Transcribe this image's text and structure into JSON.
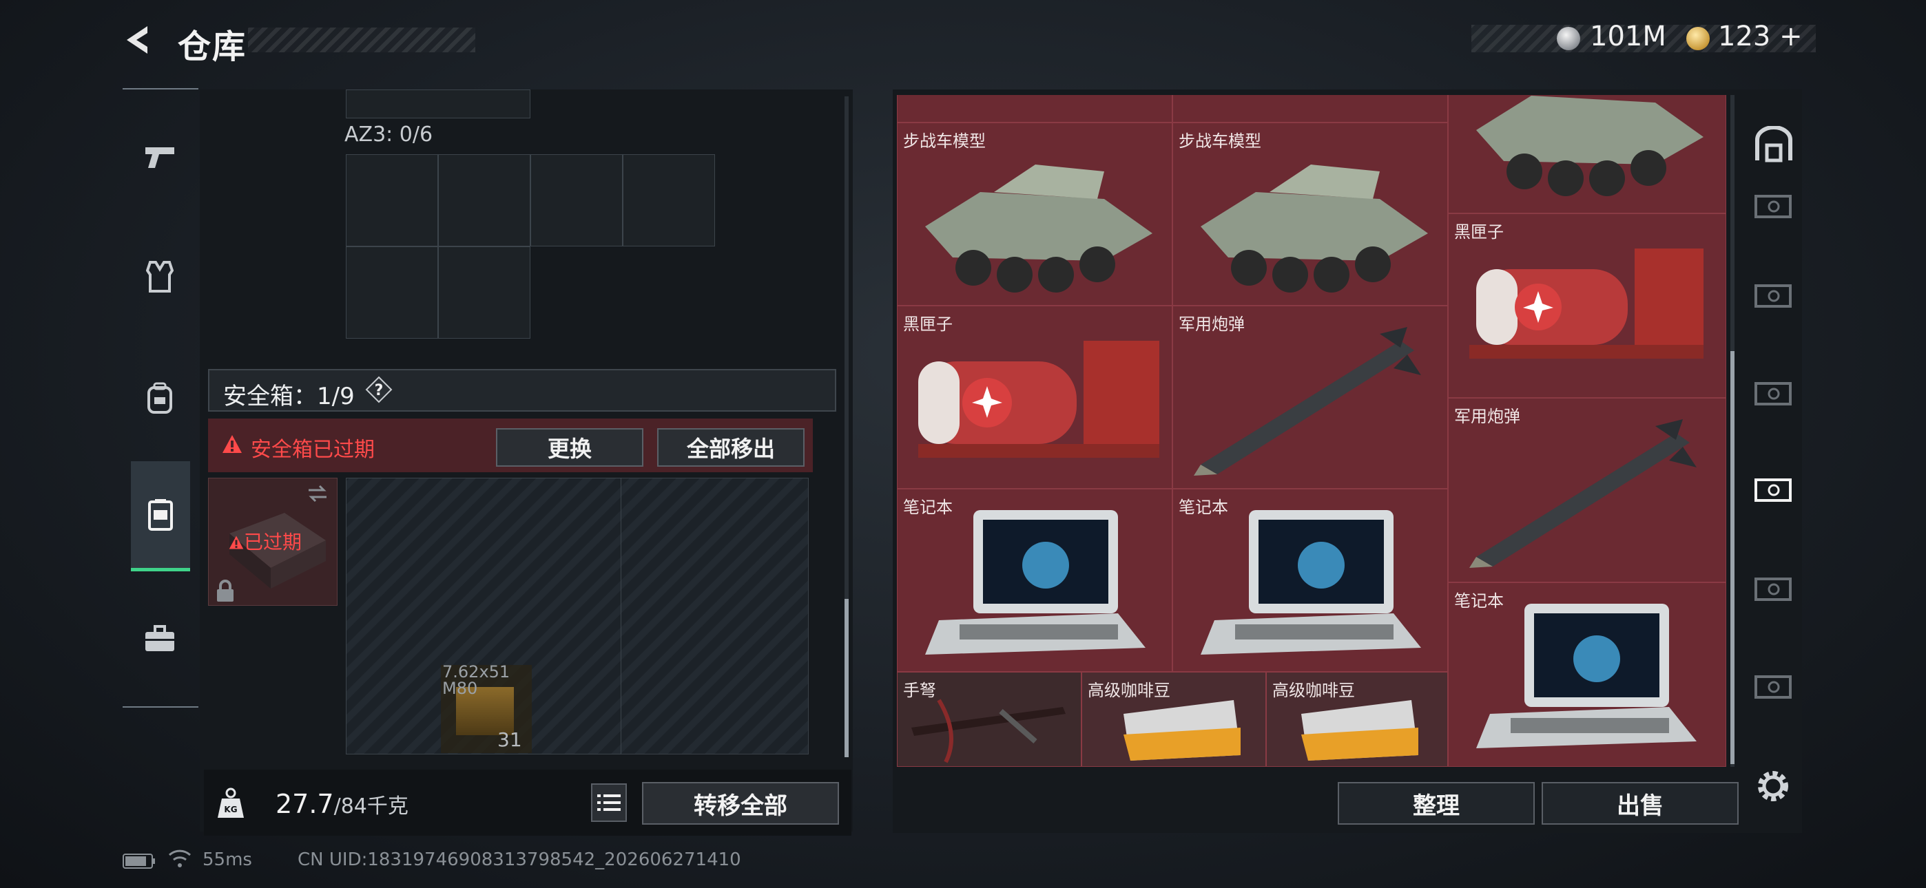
{
  "header": {
    "title": "仓库",
    "currency": [
      {
        "icon": "silver-coin-icon",
        "value": "101M"
      },
      {
        "icon": "gold-coin-icon",
        "value": "123"
      }
    ],
    "currency_plus": "+"
  },
  "nav": [
    {
      "icon": "pistol-icon"
    },
    {
      "icon": "vest-icon"
    },
    {
      "icon": "backpack-icon"
    },
    {
      "icon": "safe-box-icon",
      "active": true
    },
    {
      "icon": "briefcase-icon"
    }
  ],
  "container": {
    "az3_label": "AZ3: 0/6",
    "safe_label": "安全箱：1/9",
    "help": "?",
    "alert_text": "安全箱已过期",
    "replace_label": "更换",
    "move_all_label": "全部移出",
    "expired_tag": "已过期",
    "ammo_name_1": "7.62x51",
    "ammo_name_2": "M80",
    "ammo_count": "31"
  },
  "weight": {
    "current": "27.7",
    "max": "/84千克"
  },
  "transfer_all_label": "转移全部",
  "inventory": {
    "items": [
      {
        "name": "步战车模型"
      },
      {
        "name": "步战车模型"
      },
      {
        "name": "黑匣子"
      },
      {
        "name": "黑匣子"
      },
      {
        "name": "军用炮弹"
      },
      {
        "name": "军用炮弹"
      },
      {
        "name": "笔记本"
      },
      {
        "name": "笔记本"
      },
      {
        "name": "笔记本"
      },
      {
        "name": "手弩"
      },
      {
        "name": "高级咖啡豆"
      },
      {
        "name": "高级咖啡豆"
      }
    ],
    "sort_label": "整理",
    "sell_label": "出售"
  },
  "footer": {
    "ping": "55ms",
    "uid": "CN UID:18319746908313798542_202606271410"
  },
  "colors": {
    "accent_green": "#3fd38a",
    "alert_red": "#ff4a4a",
    "item_bg": "#6b2a32"
  }
}
